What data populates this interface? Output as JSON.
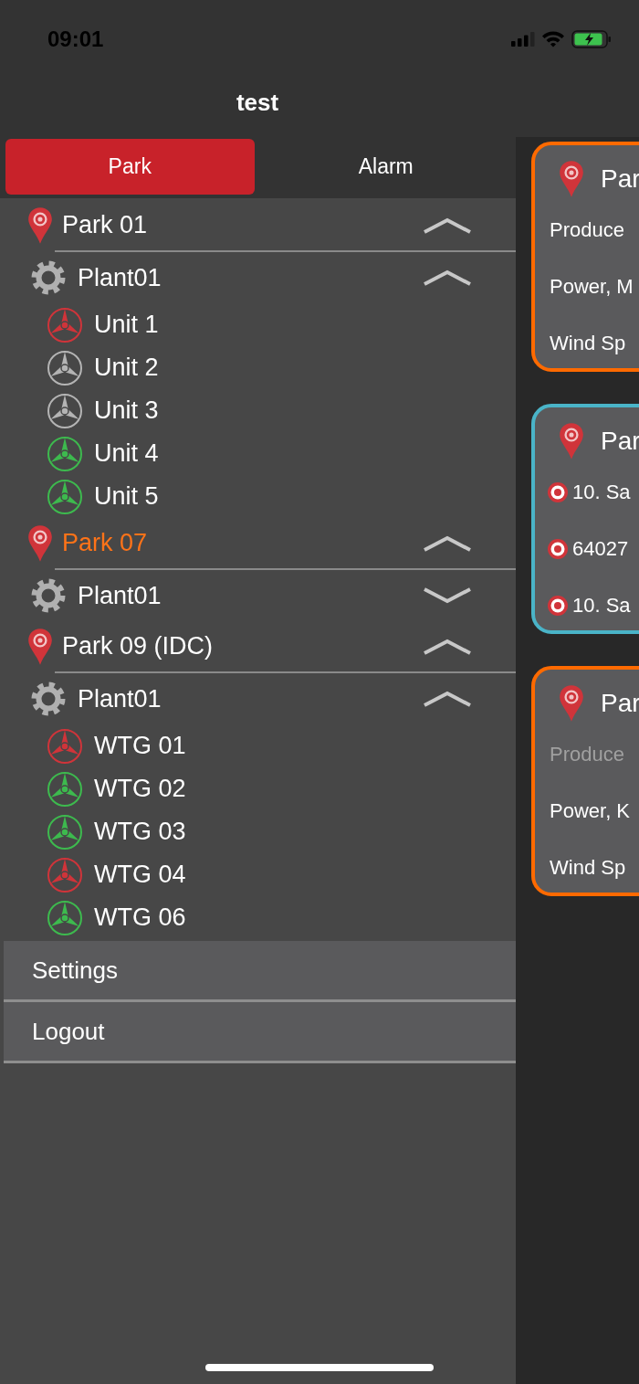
{
  "status_bar": {
    "time": "09:01"
  },
  "nav": {
    "title": "test"
  },
  "tabs": [
    {
      "label": "Park",
      "selected": true
    },
    {
      "label": "Alarm",
      "selected": false
    }
  ],
  "parks": [
    {
      "name": "Park 01",
      "selected": false,
      "expanded": true,
      "children": [
        {
          "name": "Plant01",
          "expanded": true,
          "children": [
            {
              "name": "Unit 1",
              "color": "#d0343a"
            },
            {
              "name": "Unit 2",
              "color": "#b4b4b4"
            },
            {
              "name": "Unit 3",
              "color": "#b4b4b4"
            },
            {
              "name": "Unit 4",
              "color": "#3dba4e"
            },
            {
              "name": "Unit 5",
              "color": "#3dba4e"
            }
          ]
        }
      ]
    },
    {
      "name": "Park 07",
      "selected": true,
      "expanded": true,
      "children": [
        {
          "name": "Plant01",
          "expanded": false
        }
      ]
    },
    {
      "name": "Park 09 (IDC)",
      "selected": false,
      "expanded": true,
      "children": [
        {
          "name": "Plant01",
          "expanded": true,
          "children": [
            {
              "name": "WTG 01",
              "color": "#d0343a"
            },
            {
              "name": "WTG 02",
              "color": "#3dba4e"
            },
            {
              "name": "WTG 03",
              "color": "#3dba4e"
            },
            {
              "name": "WTG 04",
              "color": "#d0343a"
            },
            {
              "name": "WTG 06",
              "color": "#3dba4e"
            }
          ]
        }
      ]
    }
  ],
  "menu": [
    {
      "label": "Settings"
    },
    {
      "label": "Logout"
    }
  ],
  "cards": [
    {
      "kind": "stats",
      "color": "#ff6a00",
      "title": "Par",
      "lines": [
        {
          "text": "Produce",
          "dimmed": false
        },
        {
          "text": "Power, M",
          "dimmed": false
        },
        {
          "text": "Wind Sp",
          "dimmed": false
        }
      ]
    },
    {
      "kind": "alarms",
      "color": "#4ab4c8",
      "title": "Par",
      "lines": [
        {
          "text": "10. Sa",
          "dimmed": false
        },
        {
          "text": "64027",
          "dimmed": false
        },
        {
          "text": "10. Sa",
          "dimmed": false
        }
      ]
    },
    {
      "kind": "stats",
      "color": "#ff6a00",
      "title": "Par",
      "lines": [
        {
          "text": "Produce",
          "dimmed": true
        },
        {
          "text": "Power, K",
          "dimmed": false
        },
        {
          "text": "Wind Sp",
          "dimmed": false
        }
      ]
    }
  ]
}
